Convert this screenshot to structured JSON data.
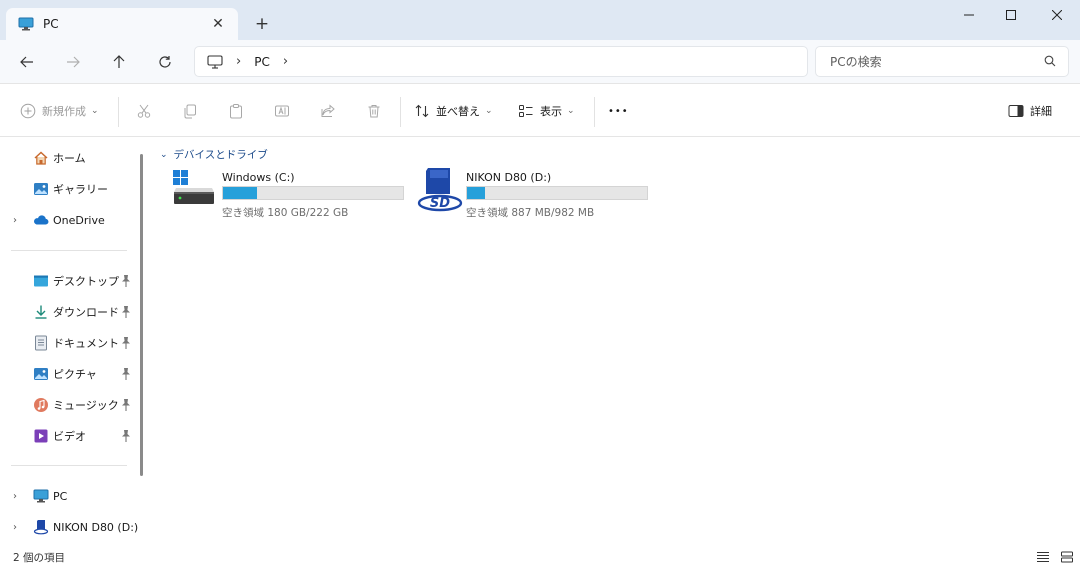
{
  "tab": {
    "title": "PC",
    "close_glyph": "✕",
    "new_tab_glyph": "+"
  },
  "window": {
    "minimize_glyph": "—",
    "maximize_glyph": "☐",
    "close_glyph": "✕"
  },
  "nav": {
    "back_glyph": "←",
    "forward_glyph": "→",
    "up_glyph": "↑",
    "refresh_glyph": "↻"
  },
  "address": {
    "separator": "›",
    "crumbs": [
      "PC"
    ]
  },
  "search": {
    "placeholder": "PCの検索"
  },
  "commands": {
    "new_label": "新規作成",
    "sort_label": "並べ替え",
    "view_label": "表示",
    "more_glyph": "•••",
    "details_label": "詳細",
    "chevron_glyph": "⌄"
  },
  "sidebar": {
    "expander_glyph": "›",
    "quick": [
      {
        "label": "ホーム",
        "icon": "home-icon"
      },
      {
        "label": "ギャラリー",
        "icon": "gallery-icon"
      },
      {
        "label": "OneDrive",
        "icon": "onedrive-icon"
      }
    ],
    "pinned": [
      {
        "label": "デスクトップ",
        "icon": "desktop-icon"
      },
      {
        "label": "ダウンロード",
        "icon": "download-icon"
      },
      {
        "label": "ドキュメント",
        "icon": "documents-icon"
      },
      {
        "label": "ピクチャ",
        "icon": "pictures-icon"
      },
      {
        "label": "ミュージック",
        "icon": "music-icon"
      },
      {
        "label": "ビデオ",
        "icon": "videos-icon"
      }
    ],
    "devices": [
      {
        "label": "PC",
        "icon": "pc-icon"
      },
      {
        "label": "NIKON D80 (D:)",
        "icon": "sd-card-icon"
      }
    ]
  },
  "main": {
    "group_title": "デバイスとドライブ",
    "group_chevron": "⌄",
    "drives": [
      {
        "name": "Windows (C:)",
        "free_text": "空き領域 180 GB/222 GB",
        "used_fraction": 0.19,
        "icon": "windows-drive-icon"
      },
      {
        "name": "NIKON D80 (D:)",
        "free_text": "空き領域 887 MB/982 MB",
        "used_fraction": 0.1,
        "icon": "sd-card-icon"
      }
    ]
  },
  "status": {
    "item_count": "2 個の項目"
  },
  "colors": {
    "accent": "#26a0da",
    "titlebar": "#dfe8f3",
    "group_header": "#1b4a8a"
  }
}
